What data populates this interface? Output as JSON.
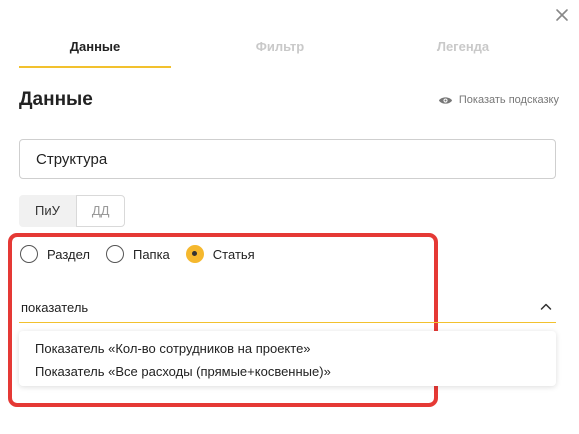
{
  "dialog": {
    "close_icon": "close-icon"
  },
  "tabs": [
    {
      "label": "Данные",
      "active": true
    },
    {
      "label": "Фильтр",
      "active": false
    },
    {
      "label": "Легенда",
      "active": false
    }
  ],
  "section": {
    "title": "Данные",
    "hint_label": "Показать подсказку",
    "hint_icon": "eye-icon"
  },
  "structure_input": {
    "value": "Структура"
  },
  "segmented": {
    "options": [
      "ПиУ",
      "ДД"
    ],
    "selected": "ПиУ"
  },
  "radio_group": {
    "options": [
      "Раздел",
      "Папка",
      "Статья"
    ],
    "selected": "Статья"
  },
  "indicator_select": {
    "value": "показатель",
    "chevron_icon": "chevron-up-icon",
    "options": [
      "Показатель «Кол-во сотрудников на проекте»",
      "Показатель «Все расходы (прямые+косвенные)»"
    ]
  },
  "colors": {
    "accent": "#f2c12e",
    "highlight": "#e53935"
  }
}
